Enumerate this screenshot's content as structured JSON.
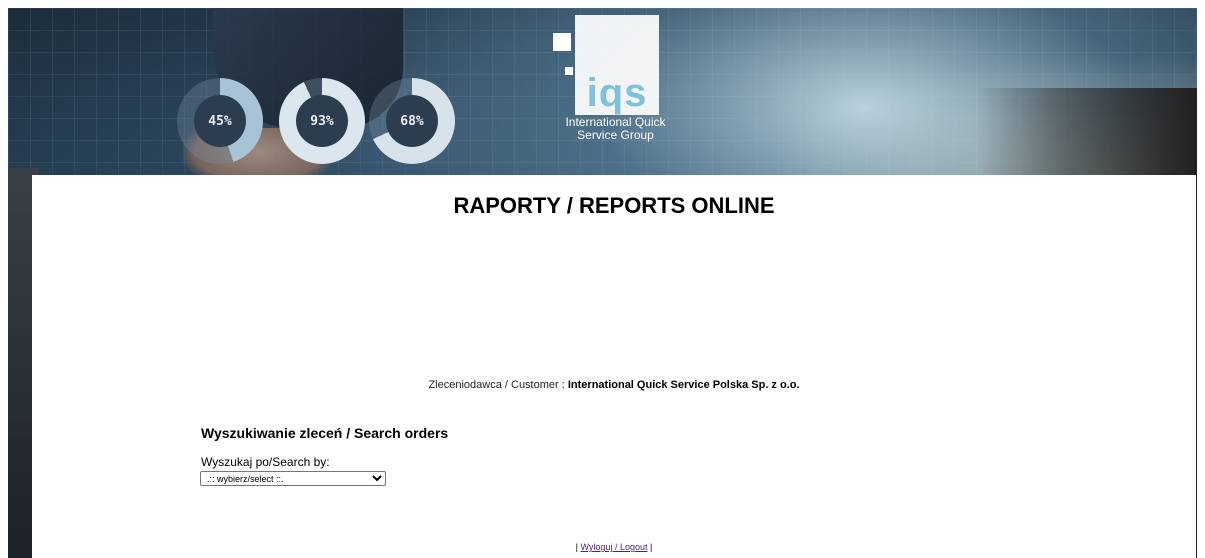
{
  "header": {
    "logo": {
      "letters": "iqs",
      "tagline_line1": "International Quick",
      "tagline_line2": "Service Group"
    },
    "gauges": [
      {
        "label": "45%",
        "value": 0.45,
        "color": "#a9c3d6"
      },
      {
        "label": "93%",
        "value": 0.93,
        "color": "#dbe6ee"
      },
      {
        "label": "68%",
        "value": 0.68,
        "color": "#d7e2ea"
      }
    ]
  },
  "main": {
    "title": "RAPORTY / REPORTS ONLINE",
    "customer_label": "Zleceniodawca / Customer :",
    "customer_value": "International Quick Service Polska Sp. z o.o.",
    "search_heading": "Wyszukiwanie zleceń / Search orders",
    "search_by_label": "Wyszukaj po/Search by:",
    "search_by_selected": ".:: wybierz/select ::."
  },
  "footer": {
    "separator_left": "|",
    "logout_label": "Wyloguj / Logout",
    "separator_right": "|"
  }
}
